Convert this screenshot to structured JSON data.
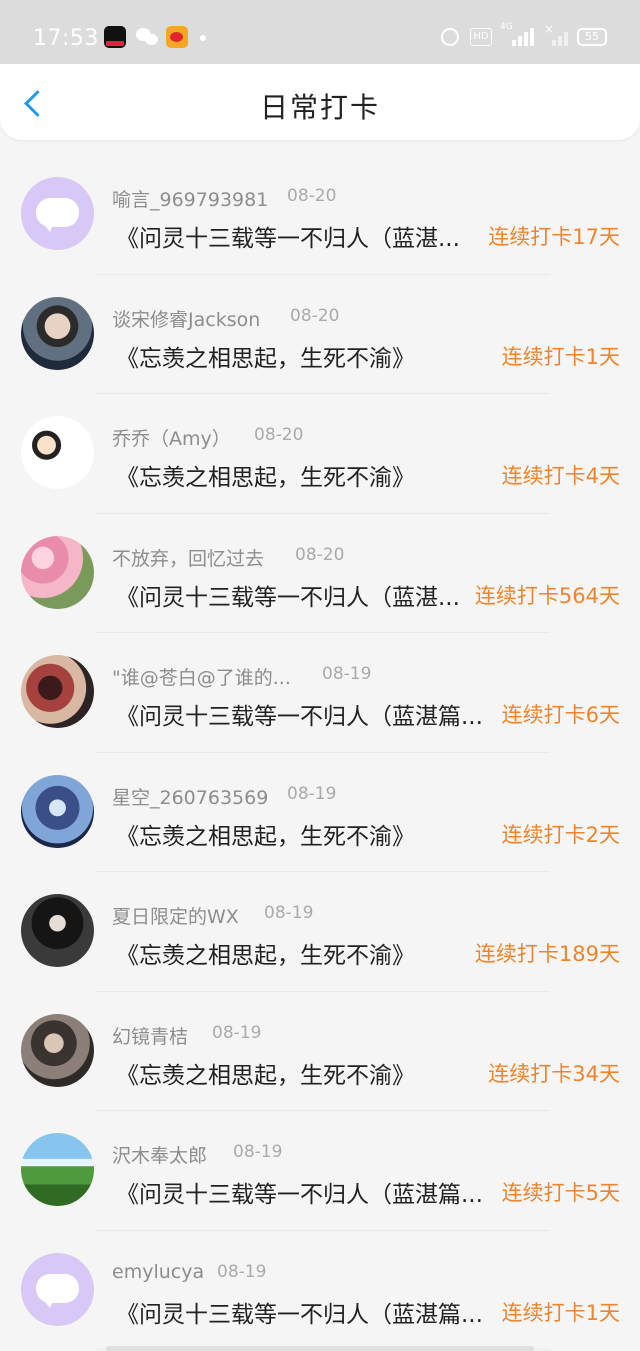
{
  "status_bar": {
    "time": "17:53",
    "network": "4G",
    "battery": "55",
    "hd": "HD",
    "icons": [
      "tiktok-icon",
      "wechat-icon",
      "weibo-icon",
      "alarm-icon",
      "hd-icon",
      "signal-icon",
      "battery-icon"
    ]
  },
  "header": {
    "title": "日常打卡",
    "back_icon": "chevron-left-icon",
    "accent": "#1e9af0"
  },
  "colors": {
    "streak": "#f0842c",
    "name": "#8d8d8d",
    "date": "#aaaaaa",
    "content": "#222222"
  },
  "items": [
    {
      "name": "喻言_969793981",
      "date": "08-20",
      "content": "《问灵十三载等一不归人（蓝湛...",
      "streak": "连续打卡17天"
    },
    {
      "name": "谈宋修睿Jackson",
      "date": "08-20",
      "content": "《忘羡之相思起，生死不渝》",
      "streak": "连续打卡1天"
    },
    {
      "name": "乔乔（Amy）",
      "date": "08-20",
      "content": "《忘羡之相思起，生死不渝》",
      "streak": "连续打卡4天"
    },
    {
      "name": "不放弃，回忆过去",
      "date": "08-20",
      "content": "《问灵十三载等一不归人（蓝湛...",
      "streak": "连续打卡564天"
    },
    {
      "name": "\"谁@苍白@了谁的...",
      "date": "08-19",
      "content": "《问灵十三载等一不归人（蓝湛篇...",
      "streak": "连续打卡6天"
    },
    {
      "name": "星空_260763569",
      "date": "08-19",
      "content": "《忘羡之相思起，生死不渝》",
      "streak": "连续打卡2天"
    },
    {
      "name": "夏日限定的WX",
      "date": "08-19",
      "content": "《忘羡之相思起，生死不渝》",
      "streak": "连续打卡189天"
    },
    {
      "name": "幻镜青桔",
      "date": "08-19",
      "content": "《忘羡之相思起，生死不渝》",
      "streak": "连续打卡34天"
    },
    {
      "name": "沢木奉太郎",
      "date": "08-19",
      "content": "《问灵十三载等一不归人（蓝湛篇...",
      "streak": "连续打卡5天"
    },
    {
      "name": "emylucya",
      "date": "08-19",
      "content": "《问灵十三载等一不归人（蓝湛篇...",
      "streak": "连续打卡1天"
    }
  ]
}
